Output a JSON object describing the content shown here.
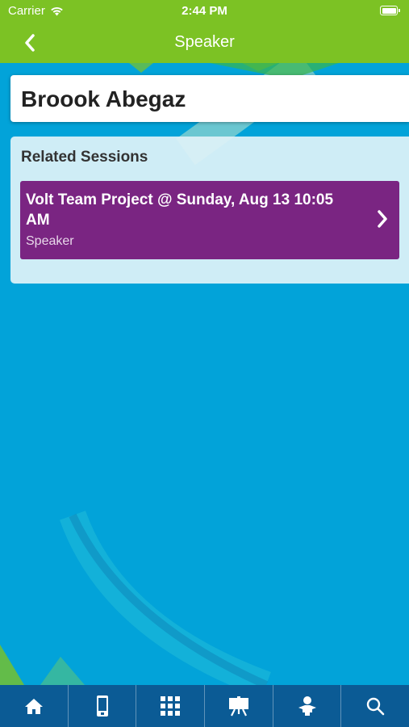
{
  "status_bar": {
    "carrier": "Carrier",
    "time": "2:44 PM"
  },
  "nav": {
    "title": "Speaker",
    "back_icon": "chevron-left-icon"
  },
  "speaker": {
    "name": "Broook Abegaz"
  },
  "related": {
    "heading": "Related Sessions",
    "sessions": [
      {
        "title": "Volt Team Project @ Sunday, Aug 13 10:05 AM",
        "role": "Speaker"
      }
    ]
  },
  "tab_bar": {
    "tabs": [
      {
        "icon": "home-icon"
      },
      {
        "icon": "mobile-device-icon"
      },
      {
        "icon": "grid-icon"
      },
      {
        "icon": "presentation-easel-icon"
      },
      {
        "icon": "speaker-person-icon"
      },
      {
        "icon": "search-icon"
      }
    ]
  },
  "colors": {
    "header_green": "#7cc224",
    "background_blue": "#02a3d9",
    "session_purple": "#7a2582",
    "tab_bar_blue": "#0b5b95"
  }
}
